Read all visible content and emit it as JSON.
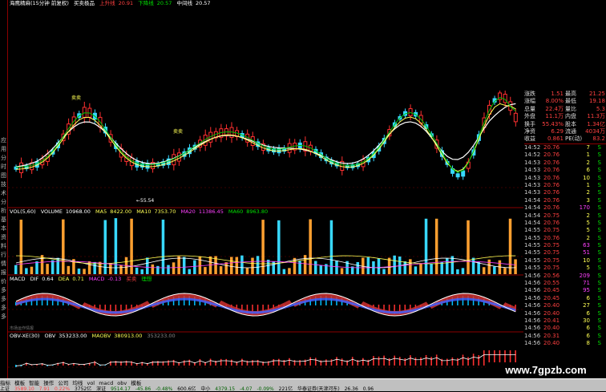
{
  "title": {
    "name": "海鹰精麻(15分钟 前复权)",
    "indicator": "买卖极品",
    "up_label": "上升线",
    "up_value": "20.91",
    "down_label": "下降线",
    "down_value": "20.57",
    "mid_label": "中间线",
    "mid_value": "20.57"
  },
  "left_sidebar": [
    "应",
    "用",
    "分",
    "时",
    "图",
    "技",
    "术",
    "分",
    "析",
    "基",
    "本",
    "资",
    "料",
    "行",
    "情",
    "报",
    "价",
    "多",
    "多",
    "多",
    "多"
  ],
  "annotations": {
    "buy1": "卖卖",
    "buy2": "卖卖",
    "low_price": "←55.54"
  },
  "vol_panel": {
    "name": "VOL(5,60)",
    "volume_label": "VOLUME",
    "volume_value": "10968.00",
    "ma5_label": "MA5",
    "ma5_value": "8422.00",
    "ma10_label": "MA10",
    "ma10_value": "7353.70",
    "ma20_label": "MA20",
    "ma20_value": "11386.45",
    "ma60_label": "MA60",
    "ma60_value": "8963.80"
  },
  "macd_panel": {
    "name": "MACD",
    "dif_label": "DIF",
    "dif_value": "0.64",
    "dea_label": "DEA",
    "dea_value": "0.71",
    "macd_label": "MACD",
    "macd_value": "-0.13",
    "extra1": "买卖",
    "extra2": "理想"
  },
  "obv_panel": {
    "name": "OBV-XE(30)",
    "obv_label": "OBV",
    "obv_value": "353233.00",
    "maobv_label": "MAOBV",
    "maobv_value": "380913.00",
    "extra_value": "353233.00",
    "small_label": "市场运作情报"
  },
  "right_panel": {
    "quote_rows": [
      {
        "k1": "涨跌",
        "v1": "1.51",
        "k2": "最高",
        "v2": "21.25"
      },
      {
        "k1": "涨幅",
        "v1": "8.00%",
        "k2": "最低",
        "v2": "19.18"
      },
      {
        "k1": "总量",
        "v1": "22.4万",
        "k2": "量比",
        "v2": "5.3"
      },
      {
        "k1": "外盘",
        "v1": "11.1万",
        "k2": "内盘",
        "v2": "11.3万"
      },
      {
        "k1": "换手",
        "v1": "55.43%",
        "k2": "股本",
        "v2": "1.34亿"
      },
      {
        "k1": "净资",
        "v1": "6.29",
        "k2": "流通",
        "v2": "4034万"
      },
      {
        "k1": "收益",
        "v1": "0.861",
        "k2": "PE(动)",
        "v2": "83.2"
      }
    ],
    "ticks": [
      {
        "time": "14:52",
        "price": "20.76",
        "vol": "7",
        "dir": "S"
      },
      {
        "time": "14:52",
        "price": "20.76",
        "vol": "1",
        "dir": "S"
      },
      {
        "time": "14:53",
        "price": "20.76",
        "vol": "2",
        "dir": "S"
      },
      {
        "time": "14:53",
        "price": "20.76",
        "vol": "6",
        "dir": "S"
      },
      {
        "time": "14:53",
        "price": "20.76",
        "vol": "10",
        "dir": "S"
      },
      {
        "time": "14:53",
        "price": "20.76",
        "vol": "1",
        "dir": "S"
      },
      {
        "time": "14:53",
        "price": "20.76",
        "vol": "2",
        "dir": "S"
      },
      {
        "time": "14:54",
        "price": "20.76",
        "vol": "3",
        "dir": "S"
      },
      {
        "time": "14:54",
        "price": "20.76",
        "vol": "170",
        "dir": "S"
      },
      {
        "time": "14:54",
        "price": "20.75",
        "vol": "2",
        "dir": "S"
      },
      {
        "time": "14:54",
        "price": "20.76",
        "vol": "5",
        "dir": "S"
      },
      {
        "time": "14:55",
        "price": "20.75",
        "vol": "5",
        "dir": "S"
      },
      {
        "time": "14:55",
        "price": "20.76",
        "vol": "2",
        "dir": "S"
      },
      {
        "time": "14:55",
        "price": "20.75",
        "vol": "63",
        "dir": "S"
      },
      {
        "time": "14:55",
        "price": "20.75",
        "vol": "51",
        "dir": "S"
      },
      {
        "time": "14:55",
        "price": "20.75",
        "vol": "10",
        "dir": "S"
      },
      {
        "time": "14:55",
        "price": "20.75",
        "vol": "5",
        "dir": "S"
      },
      {
        "time": "14:56",
        "price": "20.56",
        "vol": "209",
        "dir": "S"
      },
      {
        "time": "14:56",
        "price": "20.55",
        "vol": "71",
        "dir": "S"
      },
      {
        "time": "14:56",
        "price": "20.45",
        "vol": "95",
        "dir": "S"
      },
      {
        "time": "14:56",
        "price": "20.45",
        "vol": "6",
        "dir": "S"
      },
      {
        "time": "14:56",
        "price": "20.40",
        "vol": "27",
        "dir": "S"
      },
      {
        "time": "14:56",
        "price": "20.40",
        "vol": "6",
        "dir": "S"
      },
      {
        "time": "14:56",
        "price": "20.41",
        "vol": "30",
        "dir": "S"
      },
      {
        "time": "14:56",
        "price": "20.40",
        "vol": "6",
        "dir": "S"
      },
      {
        "time": "14:56",
        "price": "20.31",
        "vol": "6",
        "dir": "S"
      },
      {
        "time": "14:56",
        "price": "20.40",
        "vol": "8",
        "dir": "S"
      }
    ]
  },
  "bottom_tabs": [
    "指标",
    "模板",
    "智能",
    "操作",
    "公司",
    "均线",
    "vol",
    "macd",
    "obv",
    "模板"
  ],
  "status": {
    "item1": "上证",
    "item2": "3589.10",
    "item3": "7.91",
    "item4": "0.22%",
    "item5": "3752亿",
    "item6": "深证",
    "item7": "9514.17",
    "item8": "-45.86",
    "item9": "-0.48%",
    "item10": "600.6亿",
    "item11": "中小",
    "item12": "4379.15",
    "item13": "-4.07",
    "item14": "-0.09%",
    "item15": "221亿",
    "item16": "华泰证券(天津河东)",
    "item17": "26.36",
    "item18": "0.96"
  },
  "watermark": "www.7gpzb.com",
  "colors": {
    "up": "#ff4040",
    "down": "#00e000",
    "cyan": "#38d8ff",
    "yellow": "#ffff54",
    "bg": "#000000"
  }
}
